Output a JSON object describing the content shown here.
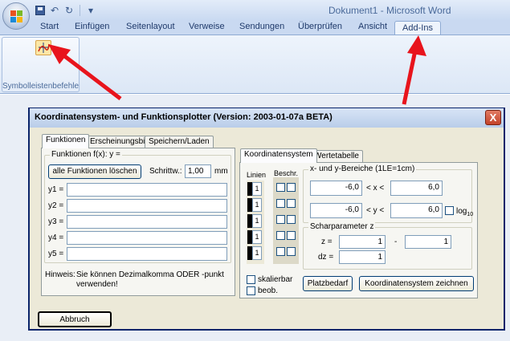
{
  "window": {
    "title": "Dokument1 - Microsoft Word"
  },
  "ribbon": {
    "tabs": [
      "Start",
      "Einfügen",
      "Seitenlayout",
      "Verweise",
      "Sendungen",
      "Überprüfen",
      "Ansicht"
    ],
    "active_tab": "Add-Ins",
    "group_label": "Symbolleistenbefehle"
  },
  "dialog": {
    "title": "Koordinatensystem- und Funktionsplotter (Version: 2003-01-07a BETA)",
    "close": "X",
    "left_tabs": [
      "Funktionen",
      "Erscheinungsbild",
      "Speichern/Laden"
    ],
    "functions_group": "Funktionen  f(x): y =",
    "clear_all_button": "alle Funktionen löschen",
    "step_label": "Schrittw.:",
    "step_value": "1,00",
    "step_unit": "mm",
    "function_rows": [
      {
        "label": "y1 =",
        "value": ""
      },
      {
        "label": "y2 =",
        "value": ""
      },
      {
        "label": "y3 =",
        "value": ""
      },
      {
        "label": "y4 =",
        "value": ""
      },
      {
        "label": "y5 =",
        "value": ""
      }
    ],
    "hint_label": "Hinweis:",
    "hint_text": "Sie können Dezimalkomma ODER -punkt",
    "hint_text2": "verwenden!",
    "cancel_button": "Abbruch",
    "right_tabs": [
      "Koordinatensystem",
      "Wertetabelle"
    ],
    "linien_label": "Linien",
    "beschr_label": "Beschr.",
    "linien_values": [
      "1",
      "1",
      "1",
      "1",
      "1"
    ],
    "range_group": "x- und y-Bereiche (1LE=1cm)",
    "x_min": "-6,0",
    "x_mid": "< x <",
    "x_max": "6,0",
    "y_min": "-6,0",
    "y_mid": "< y <",
    "y_max": "6,0",
    "log_label": "log",
    "log_sub": "10",
    "schar_group": "Scharparameter z",
    "z_label": "z =",
    "z_from": "1",
    "z_dash": "-",
    "z_to": "1",
    "dz_label": "dz =",
    "dz_value": "1",
    "scalable_label": "skalierbar",
    "observed_label": "beob.",
    "space_button": "Platzbedarf",
    "draw_button": "Koordinatensystem zeichnen"
  },
  "colors": {
    "arrow": "#e8141c",
    "dialog_bg": "#ece9d8",
    "ribbon_blue": "#c9d9f1"
  }
}
